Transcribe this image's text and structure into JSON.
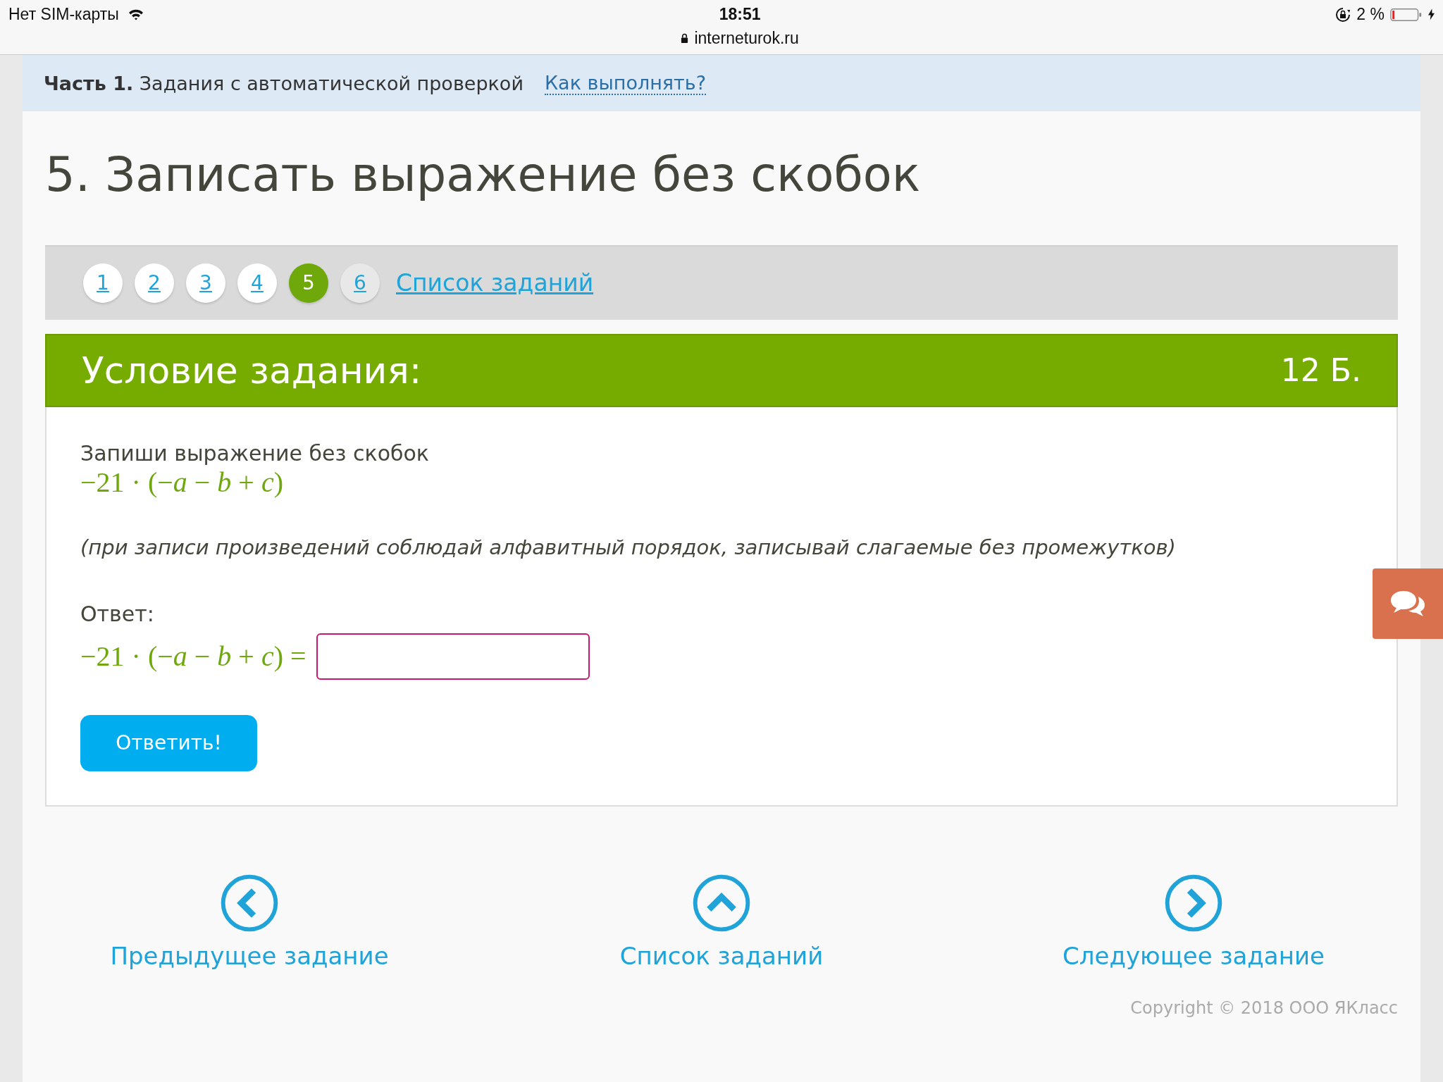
{
  "status_bar": {
    "carrier": "Нет SIM-карты",
    "time": "18:51",
    "url": "interneturok.ru",
    "battery": "2 %"
  },
  "part_banner": {
    "part": "Часть 1.",
    "title": "Задания с автоматической проверкой",
    "help_link": "Как выполнять?"
  },
  "heading": "5. Записать выражение без скобок",
  "task_nav": {
    "items": [
      {
        "label": "1",
        "selected": false,
        "visited": true
      },
      {
        "label": "2",
        "selected": false,
        "visited": true
      },
      {
        "label": "3",
        "selected": false,
        "visited": true
      },
      {
        "label": "4",
        "selected": false,
        "visited": true
      },
      {
        "label": "5",
        "selected": true,
        "visited": true
      },
      {
        "label": "6",
        "selected": false,
        "visited": false
      }
    ],
    "list_link": "Список заданий"
  },
  "task": {
    "header": "Условие задания:",
    "points": "12 Б.",
    "prompt": "Запиши выражение без скобок",
    "expression": "−21 · (−*a* − *b* + *c*)",
    "note": "(при записи произведений соблюдай алфавитный порядок, записывай слагаемые без промежутков)",
    "answer_label": "Ответ:",
    "answer_expression": "−21 · (−*a* − *b* + *c*) =",
    "submit": "Ответить!"
  },
  "bottom_nav": [
    {
      "kind": "prev",
      "label": "Предыдущее задание"
    },
    {
      "kind": "up",
      "label": "Список заданий"
    },
    {
      "kind": "next",
      "label": "Следующее задание"
    }
  ],
  "copyright": "Copyright © 2018 ООО ЯКласс"
}
